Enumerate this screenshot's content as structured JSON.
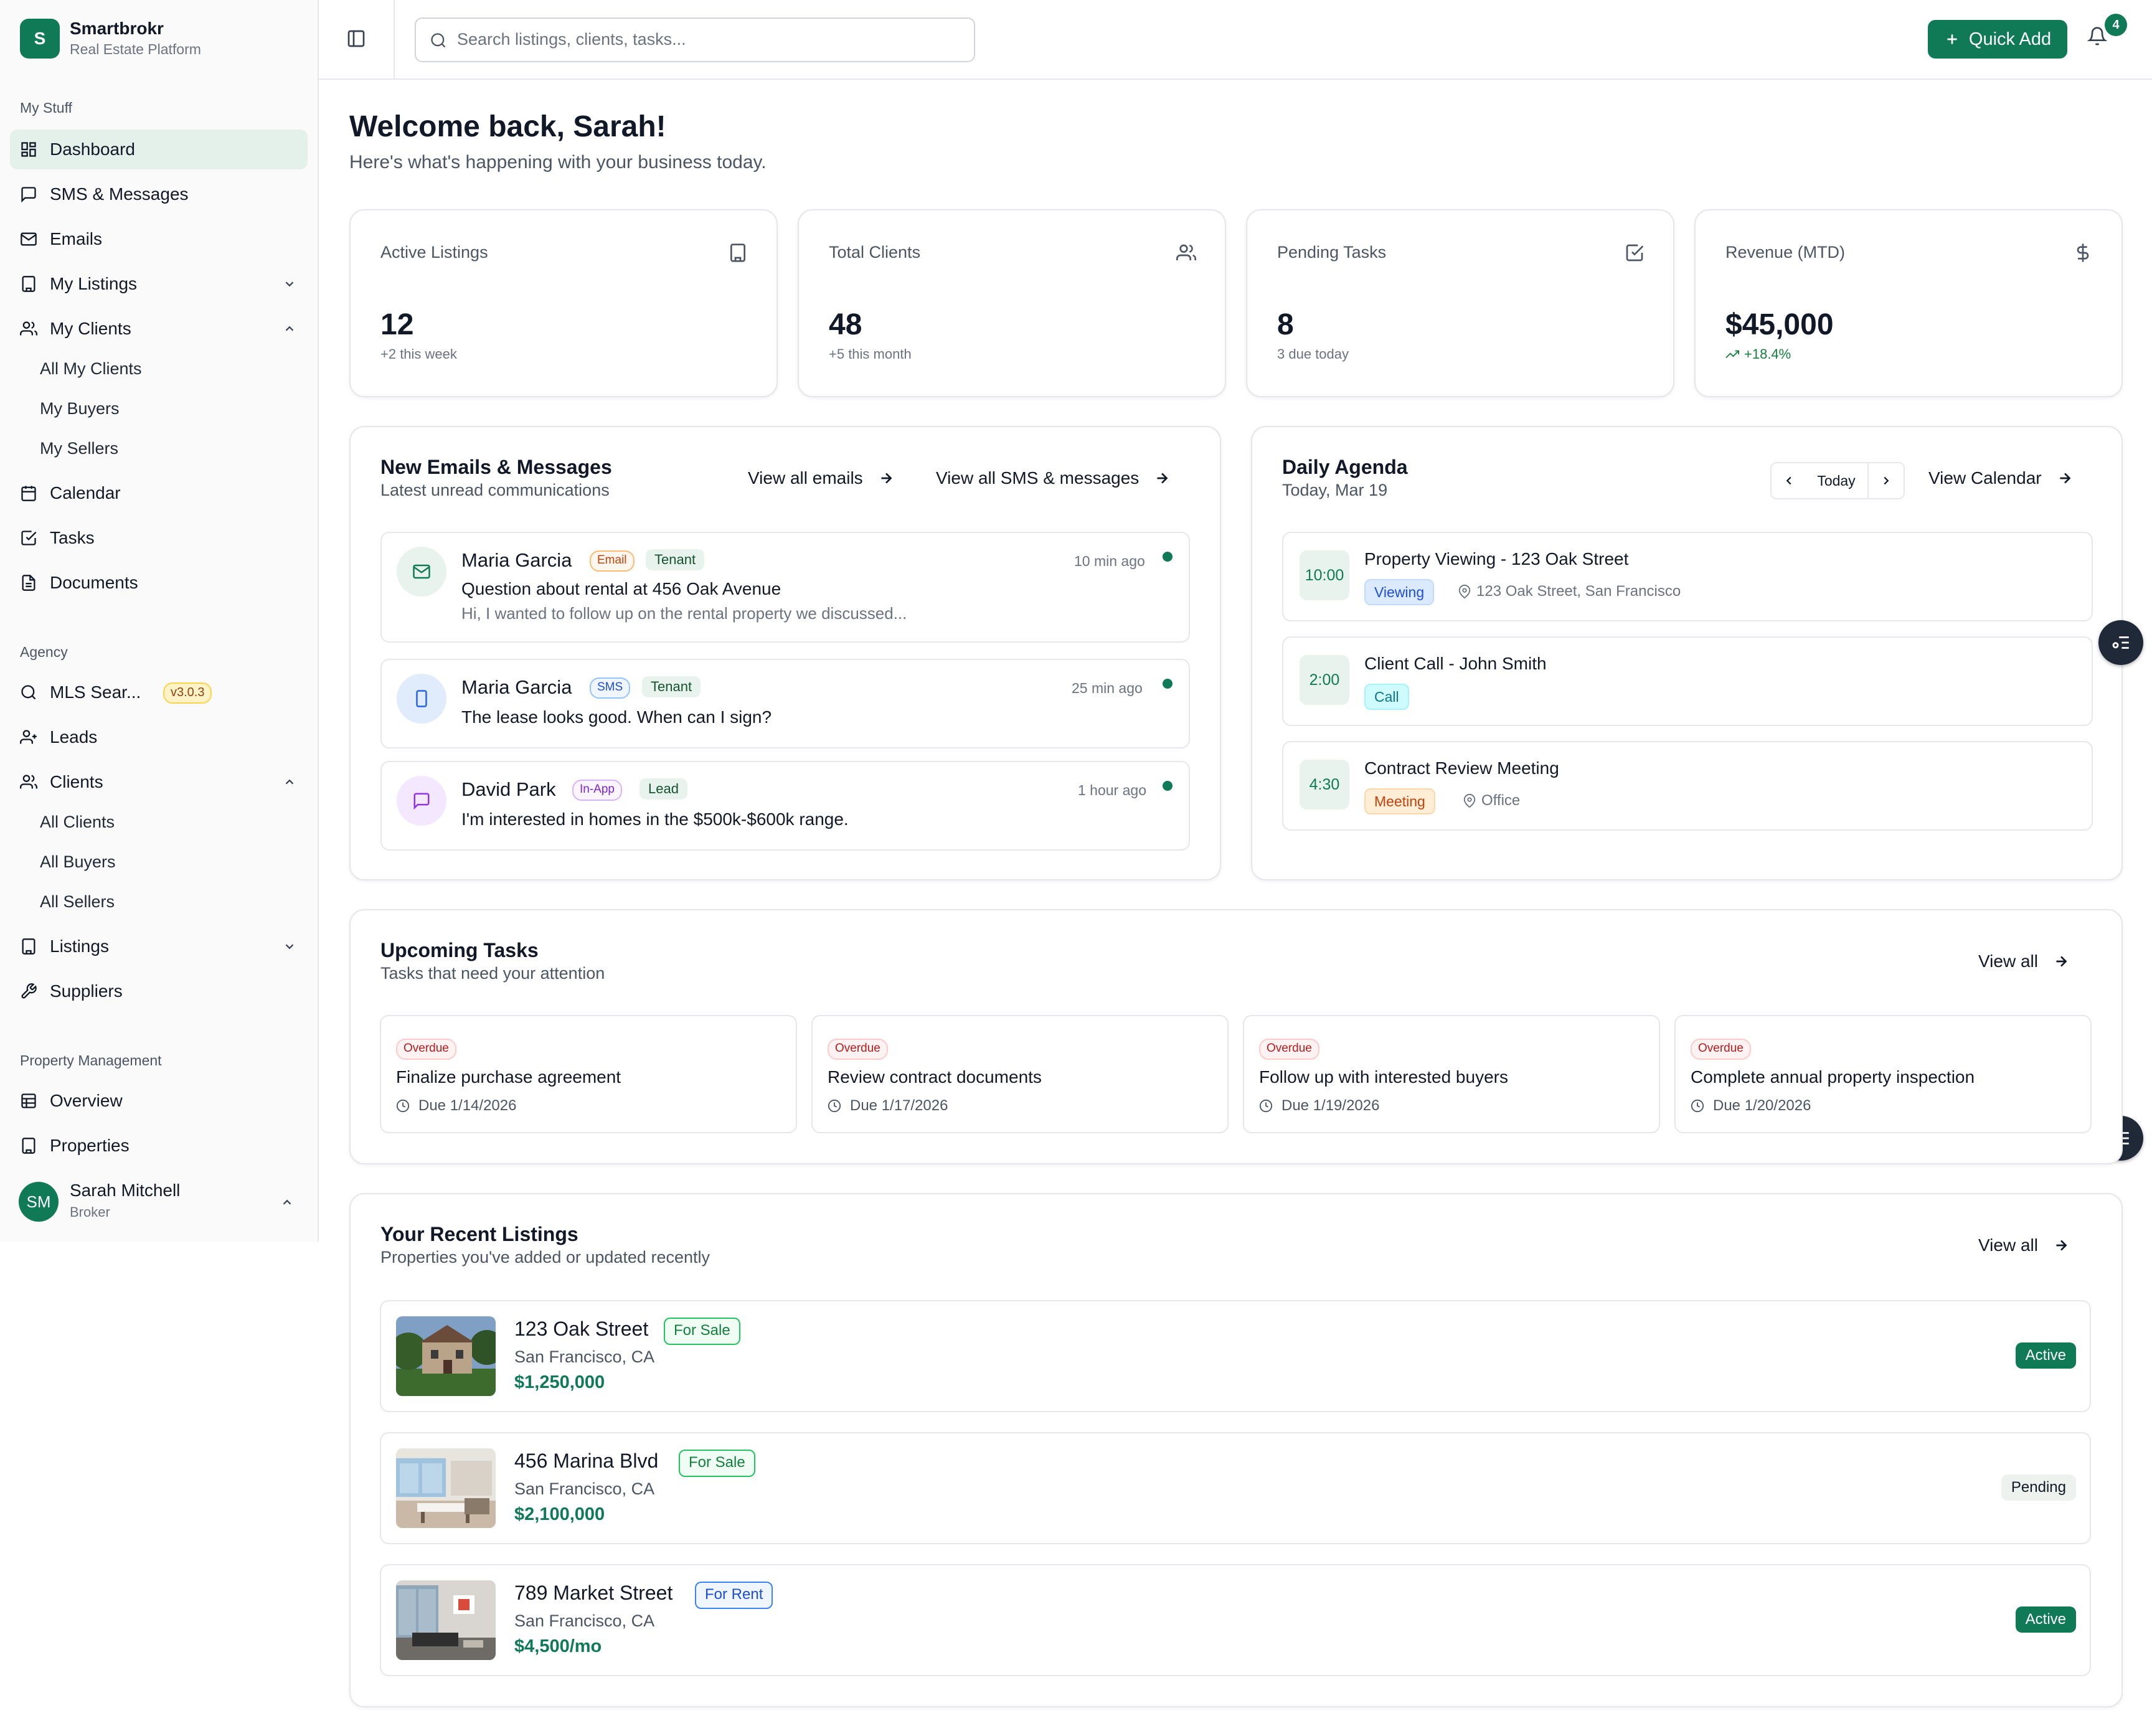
{
  "brand": {
    "initial": "S",
    "name": "Smartbrokr",
    "subtitle": "Real Estate Platform"
  },
  "sidebar": {
    "my_stuff_title": "My Stuff",
    "dashboard": "Dashboard",
    "sms": "SMS & Messages",
    "emails": "Emails",
    "my_listings": "My Listings",
    "my_clients": "My Clients",
    "my_clients_sub": [
      "All My Clients",
      "My Buyers",
      "My Sellers"
    ],
    "calendar": "Calendar",
    "tasks": "Tasks",
    "documents": "Documents",
    "agency_title": "Agency",
    "mls": "MLS Sear...",
    "mls_version": "v3.0.3",
    "leads": "Leads",
    "clients": "Clients",
    "clients_sub": [
      "All Clients",
      "All Buyers",
      "All Sellers"
    ],
    "listings": "Listings",
    "suppliers": "Suppliers",
    "pm_title": "Property Management",
    "overview": "Overview",
    "properties": "Properties"
  },
  "user": {
    "initials": "SM",
    "name": "Sarah Mitchell",
    "role": "Broker"
  },
  "topbar": {
    "search_placeholder": "Search listings, clients, tasks...",
    "quick_add": "Quick Add",
    "notif_count": "4"
  },
  "welcome": {
    "title": "Welcome back, Sarah!",
    "subtitle": "Here's what's happening with your business today."
  },
  "stats": [
    {
      "label": "Active Listings",
      "value": "12",
      "sub": "+2 this week",
      "icon": "building-icon"
    },
    {
      "label": "Total Clients",
      "value": "48",
      "sub": "+5 this month",
      "icon": "users-icon"
    },
    {
      "label": "Pending Tasks",
      "value": "8",
      "sub": "3 due today",
      "icon": "check-square-icon"
    },
    {
      "label": "Revenue (MTD)",
      "value": "$45,000",
      "sub": "+18.4%",
      "icon": "dollar-icon"
    }
  ],
  "messages": {
    "title": "New Emails & Messages",
    "subtitle": "Latest unread communications",
    "view_emails": "View all emails",
    "view_sms": "View all SMS & messages",
    "items": [
      {
        "name": "Maria Garcia",
        "channel": "Email",
        "tag": "Tenant",
        "time": "10 min ago",
        "subject": "Question about rental at 456 Oak Avenue",
        "preview": "Hi, I wanted to follow up on the rental property we discussed..."
      },
      {
        "name": "Maria Garcia",
        "channel": "SMS",
        "tag": "Tenant",
        "time": "25 min ago",
        "subject": "The lease looks good. When can I sign?"
      },
      {
        "name": "David Park",
        "channel": "In-App",
        "tag": "Lead",
        "time": "1 hour ago",
        "subject": "I'm interested in homes in the $500k-$600k range."
      }
    ]
  },
  "agenda": {
    "title": "Daily Agenda",
    "subtitle": "Today, Mar 19",
    "today": "Today",
    "view_calendar": "View Calendar",
    "items": [
      {
        "time": "10:00",
        "title": "Property Viewing - 123 Oak Street",
        "type": "Viewing",
        "location": "123 Oak Street, San Francisco"
      },
      {
        "time": "2:00",
        "title": "Client Call - John Smith",
        "type": "Call"
      },
      {
        "time": "4:30",
        "title": "Contract Review Meeting",
        "type": "Meeting",
        "location": "Office"
      }
    ]
  },
  "tasks": {
    "title": "Upcoming Tasks",
    "subtitle": "Tasks that need your attention",
    "view_all": "View all",
    "items": [
      {
        "status": "Overdue",
        "title": "Finalize purchase agreement",
        "due": "Due 1/14/2026"
      },
      {
        "status": "Overdue",
        "title": "Review contract documents",
        "due": "Due 1/17/2026"
      },
      {
        "status": "Overdue",
        "title": "Follow up with interested buyers",
        "due": "Due 1/19/2026"
      },
      {
        "status": "Overdue",
        "title": "Complete annual property inspection",
        "due": "Due 1/20/2026"
      }
    ]
  },
  "listings": {
    "title": "Your Recent Listings",
    "subtitle": "Properties you've added or updated recently",
    "view_all": "View all",
    "items": [
      {
        "address": "123 Oak Street",
        "type": "For Sale",
        "city": "San Francisco, CA",
        "price": "$1,250,000",
        "status": "Active"
      },
      {
        "address": "456 Marina Blvd",
        "type": "For Sale",
        "city": "San Francisco, CA",
        "price": "$2,100,000",
        "status": "Pending"
      },
      {
        "address": "789 Market Street",
        "type": "For Rent",
        "city": "San Francisco, CA",
        "price": "$4,500/mo",
        "status": "Active"
      }
    ]
  },
  "colors": {
    "brand": "#0f7a55",
    "overdue": "#b91c1c",
    "border": "#e5e7eb"
  }
}
